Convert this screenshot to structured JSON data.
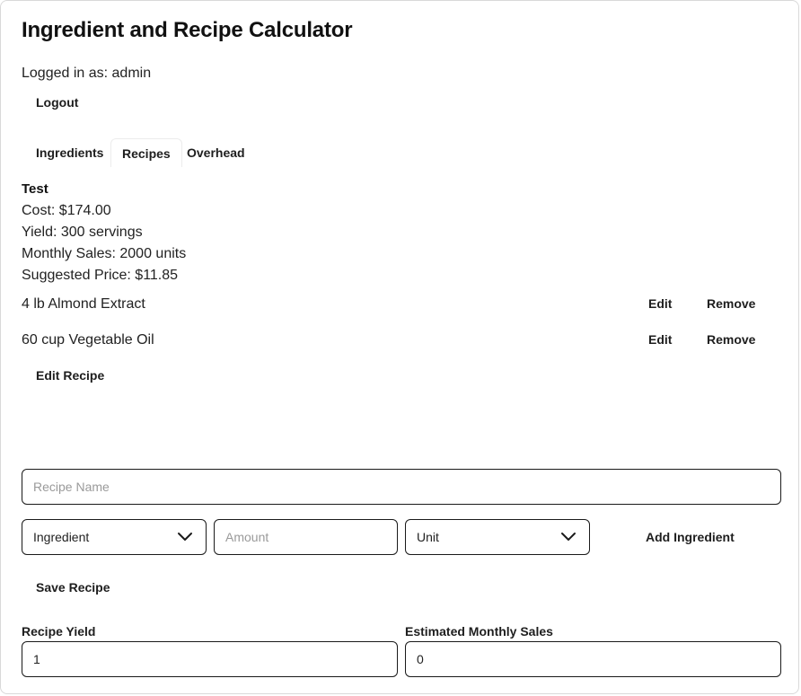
{
  "app": {
    "title": "Ingredient and Recipe Calculator"
  },
  "session": {
    "logged_in_text": "Logged in as: admin",
    "logout_label": "Logout"
  },
  "tabs": [
    {
      "label": "Ingredients"
    },
    {
      "label": "Recipes"
    },
    {
      "label": "Overhead"
    }
  ],
  "active_tab": "Recipes",
  "recipe": {
    "name": "Test",
    "cost": "Cost: $174.00",
    "yield": "Yield: 300 servings",
    "monthly_sales": "Monthly Sales: 2000 units",
    "suggested_price": "Suggested Price: $11.85",
    "ingredients": [
      {
        "text": "4 lb Almond Extract",
        "edit_label": "Edit",
        "remove_label": "Remove"
      },
      {
        "text": "60 cup Vegetable Oil",
        "edit_label": "Edit",
        "remove_label": "Remove"
      }
    ],
    "edit_recipe_label": "Edit Recipe"
  },
  "form": {
    "recipe_name_placeholder": "Recipe Name",
    "ingredient_select": "Ingredient",
    "amount_placeholder": "Amount",
    "unit_select": "Unit",
    "add_ingredient_label": "Add Ingredient",
    "save_recipe_label": "Save Recipe",
    "recipe_yield_label": "Recipe Yield",
    "recipe_yield_value": "1",
    "monthly_sales_label": "Estimated Monthly Sales",
    "monthly_sales_value": "0"
  },
  "icons": {
    "select_arrow": "chevron-down-icon"
  }
}
